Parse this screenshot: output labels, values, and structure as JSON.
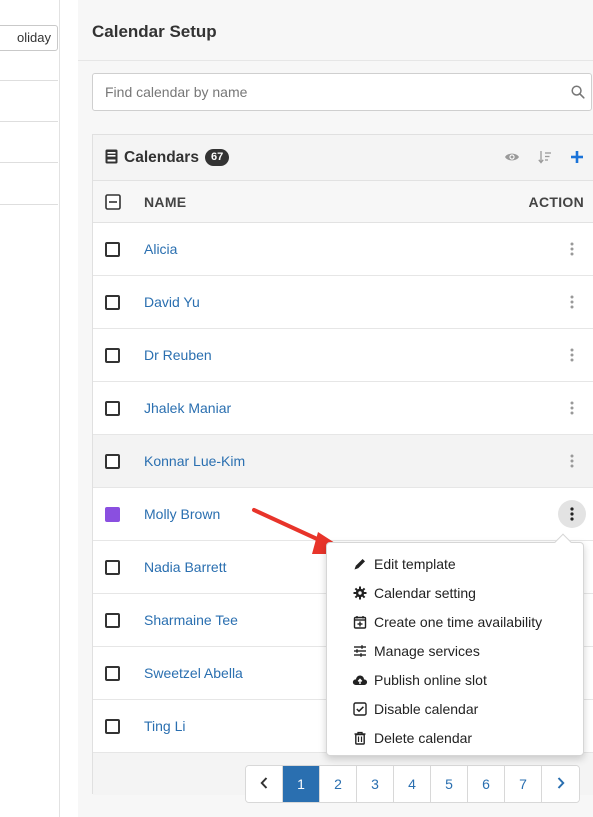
{
  "left": {
    "holiday_button_label": "oliday"
  },
  "panel": {
    "title": "Calendar Setup",
    "search": {
      "placeholder": "Find calendar by name",
      "value": ""
    }
  },
  "calendars": {
    "title": "Calendars",
    "count": "67",
    "columns": {
      "name": "NAME",
      "action": "ACTION"
    },
    "rows": [
      {
        "name": "Alicia",
        "color": ""
      },
      {
        "name": "David Yu",
        "color": ""
      },
      {
        "name": "Dr Reuben",
        "color": ""
      },
      {
        "name": "Jhalek Maniar",
        "color": ""
      },
      {
        "name": "Konnar Lue-Kim",
        "color": ""
      },
      {
        "name": "Molly Brown",
        "color": "#8a4fe0"
      },
      {
        "name": "Nadia Barrett",
        "color": ""
      },
      {
        "name": "Sharmaine Tee",
        "color": ""
      },
      {
        "name": "Sweetzel Abella",
        "color": ""
      },
      {
        "name": "Ting Li",
        "color": ""
      }
    ]
  },
  "pagination": {
    "pages": [
      "1",
      "2",
      "3",
      "4",
      "5",
      "6",
      "7"
    ],
    "current": "1"
  },
  "action_menu": {
    "items": [
      {
        "label": "Edit template",
        "icon": "pencil-icon"
      },
      {
        "label": "Calendar setting",
        "icon": "gear-icon"
      },
      {
        "label": "Create one time availability",
        "icon": "calendar-plus-icon"
      },
      {
        "label": "Manage services",
        "icon": "sliders-icon"
      },
      {
        "label": "Publish online slot",
        "icon": "cloud-upload-icon"
      },
      {
        "label": "Disable calendar",
        "icon": "checkbox-icon"
      },
      {
        "label": "Delete calendar",
        "icon": "trash-icon"
      }
    ]
  },
  "colors": {
    "link": "#2a6fb0",
    "accent": "#2a6fb0",
    "annotation_arrow": "#e8342a"
  }
}
